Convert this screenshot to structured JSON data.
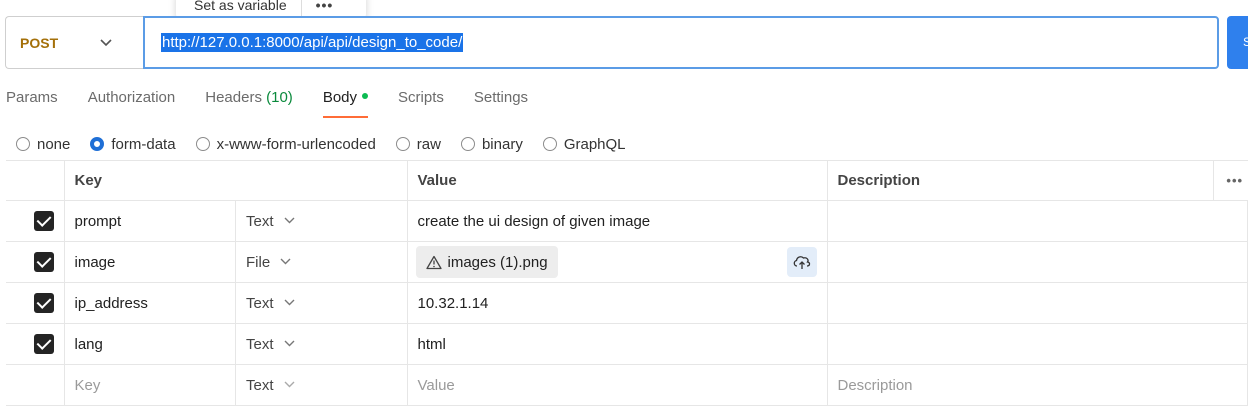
{
  "popover": {
    "label": "Set as variable",
    "more": "•••"
  },
  "request": {
    "method": "POST",
    "url": "http://127.0.0.1:8000/api/api/design_to_code/",
    "send_label": "S"
  },
  "tabs": [
    {
      "label": "Params"
    },
    {
      "label": "Authorization"
    },
    {
      "label": "Headers",
      "count": "(10)"
    },
    {
      "label": "Body"
    },
    {
      "label": "Scripts"
    },
    {
      "label": "Settings"
    }
  ],
  "body_types": [
    "none",
    "form-data",
    "x-www-form-urlencoded",
    "raw",
    "binary",
    "GraphQL"
  ],
  "selected_body_type": "form-data",
  "table": {
    "headers": {
      "key": "Key",
      "value": "Value",
      "description": "Description",
      "more": "•••"
    },
    "rows": [
      {
        "key": "prompt",
        "type": "Text",
        "value": "create the ui design of given image",
        "checked": true
      },
      {
        "key": "image",
        "type": "File",
        "value": "images (1).png",
        "checked": true
      },
      {
        "key": "ip_address",
        "type": "Text",
        "value": "10.32.1.14",
        "checked": true
      },
      {
        "key": "lang",
        "type": "Text",
        "value": "html",
        "checked": true
      }
    ],
    "placeholder": {
      "key": "Key",
      "type": "Text",
      "value": "Value",
      "description": "Description"
    }
  },
  "colors": {
    "accent": "#ff6c37",
    "url_selection": "#1a73e8",
    "method": "#a4700a",
    "count": "#0a8a3c",
    "dot": "#0cbb52"
  }
}
